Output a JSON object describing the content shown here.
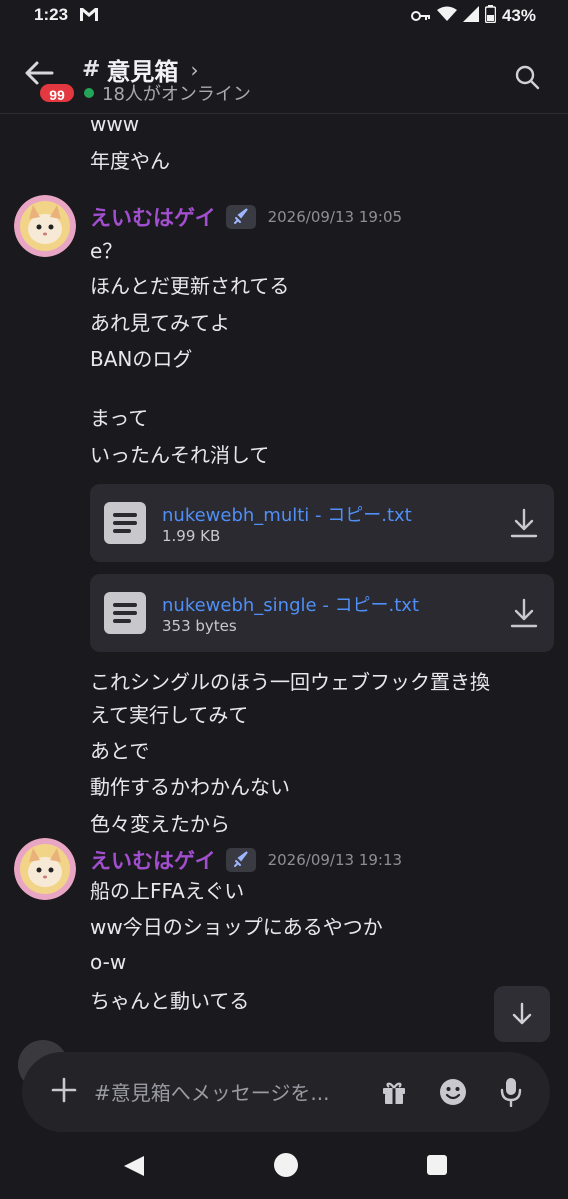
{
  "status_bar": {
    "time": "1:23",
    "battery": "43%"
  },
  "header": {
    "unread_count": "99",
    "channel_name": "意見箱",
    "online_text": "18人がオンライン"
  },
  "messages": {
    "prev_lines": [
      "www",
      "年度やん"
    ],
    "group1": {
      "author": "えいむはゲイ",
      "timestamp": "2026/09/13 19:05",
      "lines": [
        "e？",
        "ほんとだ更新されてる",
        "あれ見てみてよ",
        "BANのログ",
        "まって",
        "いったんそれ消して"
      ],
      "attachments": [
        {
          "name": "nukewebh_multi - コピー.txt",
          "size": "1.99 KB"
        },
        {
          "name": "nukewebh_single - コピー.txt",
          "size": "353 bytes"
        }
      ],
      "after_lines": [
        "これシングルのほう一回ウェブフック置き換",
        "えて実行してみて",
        "あとで",
        "動作するかわかんない",
        "色々変えたから"
      ]
    },
    "group2": {
      "author": "えいむはゲイ",
      "timestamp": "2026/09/13 19:13",
      "lines": [
        "船の上FFAえぐい",
        "ww今日のショップにあるやつか",
        "o-w",
        "ちゃんと動いてる"
      ]
    }
  },
  "composer": {
    "placeholder": "#意見箱へメッセージを..."
  },
  "colors": {
    "background": "#1a1a1e",
    "author": "#a24fcf",
    "link": "#4f8ff7",
    "badge": "#e3383f",
    "online": "#23a55a"
  }
}
